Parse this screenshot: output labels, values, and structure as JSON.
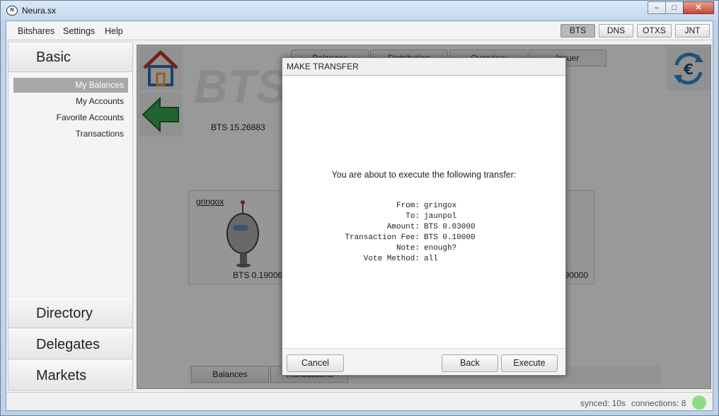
{
  "window": {
    "title": "Neura.sx",
    "icon_name": "neura-logo-icon",
    "controls": [
      "minimize-icon",
      "maximize-icon",
      "close-icon"
    ]
  },
  "menubar": {
    "items": [
      "Bitshares",
      "Settings",
      "Help"
    ]
  },
  "chains": [
    {
      "label": "BTS",
      "active": true
    },
    {
      "label": "DNS",
      "active": false
    },
    {
      "label": "OTXS",
      "active": false
    },
    {
      "label": "JNT",
      "active": false
    }
  ],
  "nav": {
    "basic": "Basic",
    "sub_items": [
      {
        "label": "My Balances",
        "active": true
      },
      {
        "label": "My Accounts",
        "active": false
      },
      {
        "label": "Favorite Accounts",
        "active": false
      },
      {
        "label": "Transactions",
        "active": false
      }
    ],
    "directory": "Directory",
    "delegates": "Delegates",
    "markets": "Markets"
  },
  "main": {
    "asset_watermark": "BTS",
    "balance": "BTS 15.26883",
    "top_tabs": [
      "Balances",
      "Distribution",
      "Overview",
      "Issuer"
    ],
    "cards": [
      {
        "name": "gringox",
        "balance": "BTS 0.19006"
      },
      {
        "name": "",
        "balance": "90000"
      }
    ],
    "bottom_tabs": [
      "Balances",
      "Transactions"
    ],
    "icons": {
      "home": "home-icon",
      "back": "back-arrow-icon",
      "exchange": "currency-exchange-icon"
    }
  },
  "dialog": {
    "title": "MAKE TRANSFER",
    "intro": "You are about to execute the following transfer:",
    "details": [
      {
        "label": "From:",
        "value": "gringox"
      },
      {
        "label": "To:",
        "value": "jaunpol"
      },
      {
        "label": "Amount:",
        "value": "BTS 0.03000"
      },
      {
        "label": "Transaction Fee:",
        "value": "BTS 0.10000"
      },
      {
        "label": "Note:",
        "value": "enough?"
      },
      {
        "label": "Vote Method:",
        "value": "all"
      }
    ],
    "buttons": {
      "cancel": "Cancel",
      "back": "Back",
      "execute": "Execute"
    }
  },
  "status": {
    "synced": "synced: 10s",
    "connections": "connections: 8",
    "indicator_color": "#8fdb85"
  }
}
